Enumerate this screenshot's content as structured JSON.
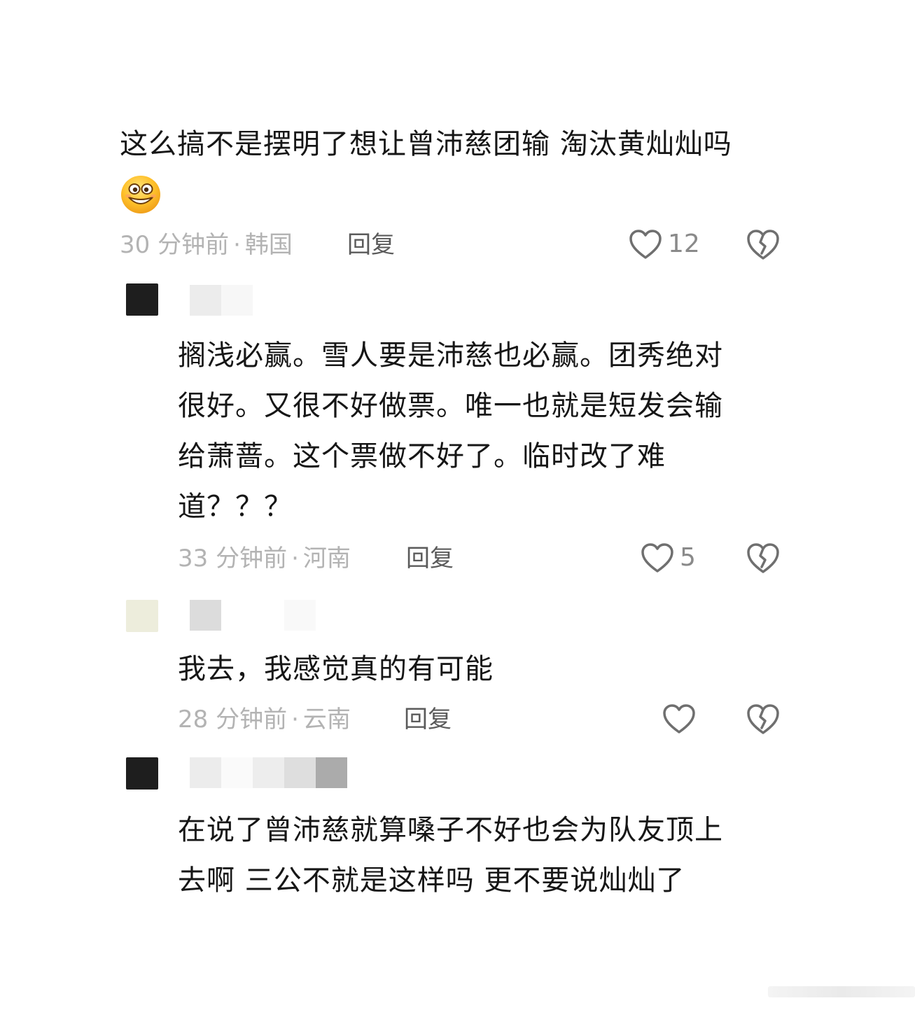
{
  "top_comment": {
    "text": "这么搞不是摆明了想让曾沛慈团输 淘汰黄灿灿吗",
    "emoji": "grinning-face-emoji",
    "time": "30 分钟前",
    "separator": "·",
    "location": "韩国",
    "reply_label": "回复",
    "like_count": "12"
  },
  "replies": [
    {
      "text": "搁浅必赢。雪人要是沛慈也必赢。团秀绝对\n很好。又很不好做票。唯一也就是短发会输\n给萧蔷。这个票做不好了。临时改了难\n道？？？",
      "time": "33 分钟前",
      "separator": "·",
      "location": "河南",
      "reply_label": "回复",
      "like_count": "5"
    },
    {
      "text": "我去，我感觉真的有可能",
      "time": "28 分钟前",
      "separator": "·",
      "location": "云南",
      "reply_label": "回复",
      "like_count": ""
    },
    {
      "text": "在说了曾沛慈就算嗓子不好也会为队友顶上\n去啊 三公不就是这样吗 更不要说灿灿了"
    }
  ],
  "icons": {
    "like": "heart-outline-icon",
    "dislike": "broken-heart-icon"
  },
  "colors": {
    "text": "#161616",
    "meta": "#b3b3b3",
    "reply": "#5b5b5b",
    "icon": "#6f6f6f",
    "count": "#8a8a8a"
  }
}
